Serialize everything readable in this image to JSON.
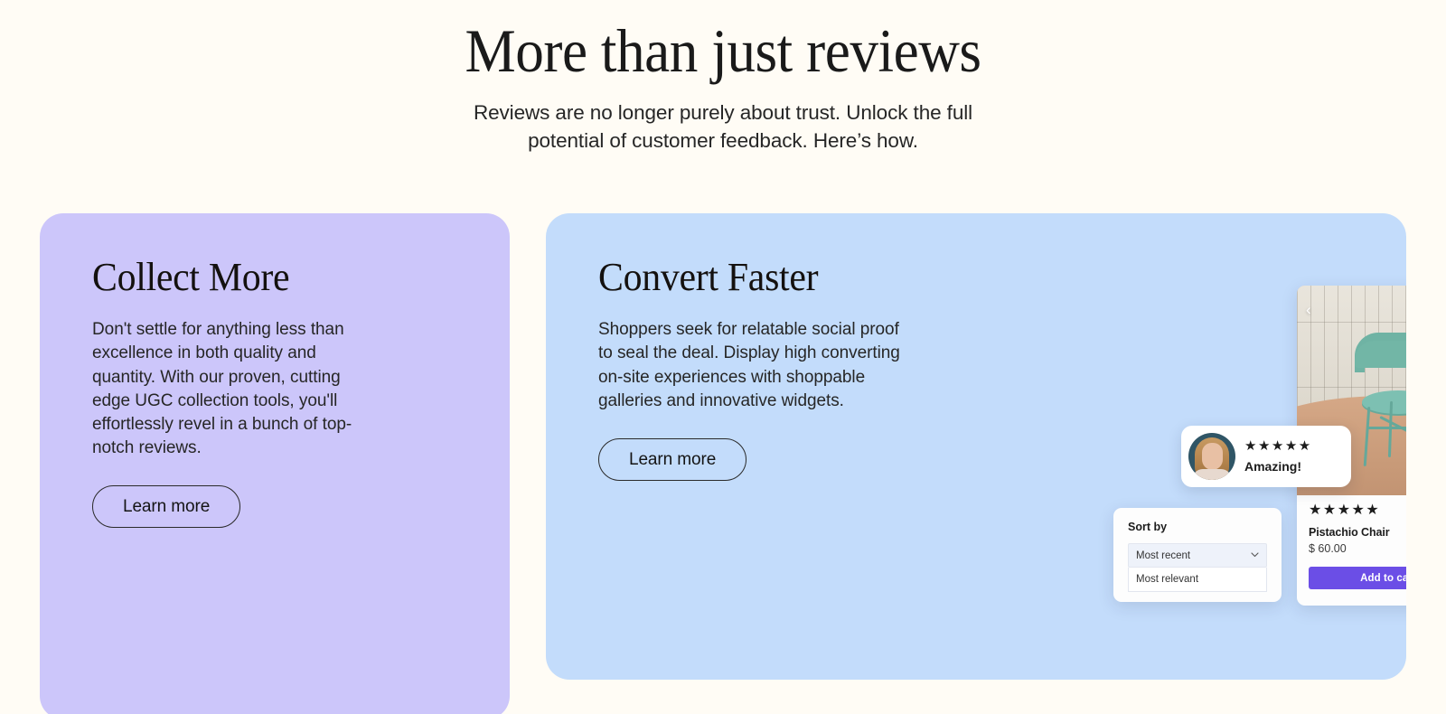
{
  "header": {
    "title": "More than just reviews",
    "subtitle": "Reviews are no longer purely about trust. Unlock the full potential of customer feedback. Here’s how."
  },
  "cards": [
    {
      "id": "collect-more",
      "title": "Collect More",
      "body": "Don't settle for anything less than excellence in both quality and quantity. With our proven, cutting edge UGC collection tools, you'll effortlessly revel in a bunch of top-notch reviews.",
      "cta": "Learn more",
      "bg_color": "#CCC6FA"
    },
    {
      "id": "convert-faster",
      "title": "Convert Faster",
      "body": "Shoppers seek for relatable social proof to seal the deal. Display high converting on-site experiences with shoppable galleries and innovative widgets.",
      "cta": "Learn more",
      "bg_color": "#C3DCFB"
    }
  ],
  "mockup": {
    "product": {
      "prev_icon": "‹",
      "cart_icon": "cart-icon",
      "stars": "★★★★★",
      "rating": 5,
      "name": "Pistachio Chair",
      "price": "$ 60.00",
      "add_to_cart_label": "Add to cart",
      "button_color": "#6B4EE6",
      "photo_alt": "pistachio green chair in a room with slatted cream wall and terracotta floor"
    },
    "review": {
      "stars": "★★★★★",
      "rating": 5,
      "text": "Amazing!",
      "avatar_alt": "portrait of a blonde woman"
    },
    "sort": {
      "label": "Sort by",
      "selected": "Most recent",
      "chevron": "⌄",
      "options": [
        "Most recent",
        "Most relevant"
      ]
    }
  },
  "theme": {
    "page_background": "#FFFCF5",
    "text_color": "#1b1b1b"
  }
}
